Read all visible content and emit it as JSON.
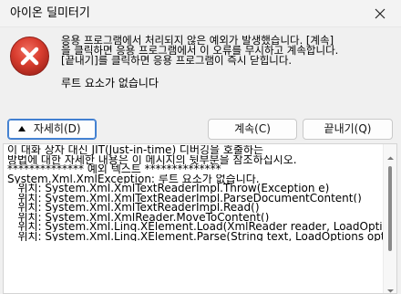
{
  "window": {
    "title": "아이온 딜미터기"
  },
  "message": {
    "lines": [
      "응용 프로그램에서 처리되지 않은 예외가 발생했습니다. [계속]",
      "을 클릭하면 응용 프로그램에서 이 오류를 무시하고 계속합니다.",
      "[끝내기]를 클릭하면 응용 프로그램이 즉시 닫힙니다."
    ],
    "reason": "루트 요소가 없습니다"
  },
  "buttons": {
    "details": "자세히(D)",
    "continue": "계속(C)",
    "quit": "끝내기(Q)"
  },
  "details": {
    "lines": [
      "이 대화 상자 대신 JIT(Just-in-time) 디버깅을 호출하는",
      "방법에 대한 자세한 내용은 이 메시지의 뒷부분을 참조하십시오.",
      "",
      "************** 예외 텍스트 **************",
      "System.Xml.XmlException: 루트 요소가 없습니다.",
      "   위치: System.Xml.XmlTextReaderImpl.Throw(Exception e)",
      "   위치: System.Xml.XmlTextReaderImpl.ParseDocumentContent()",
      "   위치: System.Xml.XmlTextReaderImpl.Read()",
      "   위치: System.Xml.XmlReader.MoveToContent()",
      "   위치: System.Xml.Linq.XElement.Load(XmlReader reader, LoadOptio",
      "   위치: System.Xml.Linq.XElement.Parse(String text, LoadOptions opti"
    ]
  },
  "icons": {
    "error": "error-icon",
    "close": "close-icon",
    "details_toggle": "chevron-up-icon",
    "scroll_up": "scroll-up-arrow-icon",
    "scroll_down": "scroll-down-arrow-icon"
  },
  "colors": {
    "error_red": "#c42b1c",
    "focus_blue": "#3b7bcf"
  }
}
